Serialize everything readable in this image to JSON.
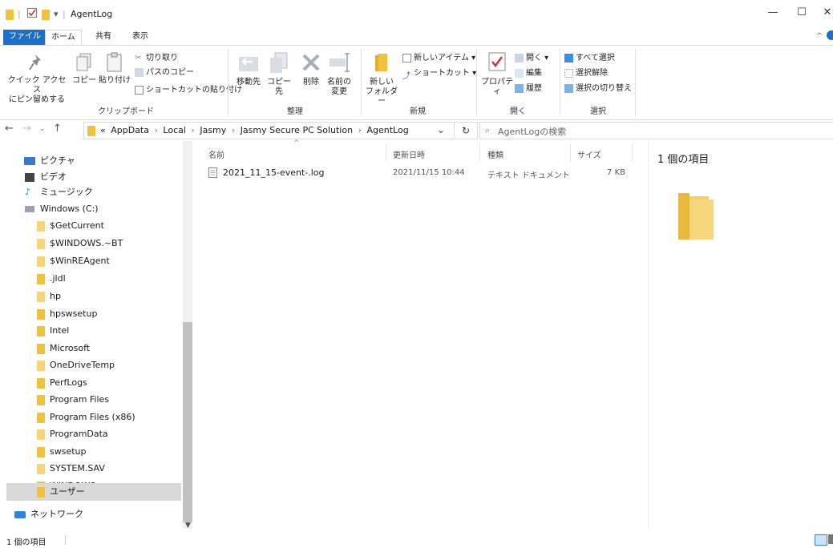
{
  "window": {
    "title": "AgentLog",
    "quick_access_sep": "|",
    "dropdown_glyph": "▾"
  },
  "ribbon_tabs": [
    "ファイル",
    "ホーム",
    "共有",
    "表示"
  ],
  "ribbon": {
    "clipboard": {
      "pin_label_1": "クイック アクセス",
      "pin_label_2": "にピン留めする",
      "copy": "コピー",
      "paste": "貼り付け",
      "cut": "切り取り",
      "copy_path": "パスのコピー",
      "paste_shortcut": "ショートカットの貼り付け",
      "group": "クリップボード"
    },
    "organize": {
      "move_to": "移動先",
      "copy_to": "コピー先",
      "delete": "削除",
      "rename_1": "名前の",
      "rename_2": "変更",
      "group": "整理"
    },
    "new": {
      "new_folder_1": "新しい",
      "new_folder_2": "フォルダー",
      "new_item": "新しいアイテム ▾",
      "shortcut": "ショートカット ▾",
      "group": "新規"
    },
    "open": {
      "properties": "プロパティ",
      "open": "開く ▾",
      "edit": "編集",
      "history": "履歴",
      "group": "開く"
    },
    "select": {
      "select_all": "すべて選択",
      "select_none": "選択解除",
      "invert": "選択の切り替え",
      "group": "選択"
    }
  },
  "address": {
    "crumbs": [
      "«",
      "AppData",
      "Local",
      "Jasmy",
      "Jasmy Secure PC Solution",
      "AgentLog"
    ],
    "search_placeholder": "AgentLogの検索",
    "refresh": "↻",
    "dropdown": "⌄"
  },
  "nav_pane": {
    "items": [
      {
        "label": "ピクチャ",
        "icon": "pictures-icon"
      },
      {
        "label": "ビデオ",
        "icon": "videos-icon"
      },
      {
        "label": "ミュージック",
        "icon": "music-icon"
      },
      {
        "label": "Windows (C:)",
        "icon": "drive-icon"
      },
      {
        "label": "$GetCurrent",
        "icon": "folder-icon"
      },
      {
        "label": "$WINDOWS.~BT",
        "icon": "folder-icon"
      },
      {
        "label": "$WinREAgent",
        "icon": "folder-icon"
      },
      {
        "label": ".jldl",
        "icon": "folder-icon"
      },
      {
        "label": "hp",
        "icon": "folder-icon"
      },
      {
        "label": "hpswsetup",
        "icon": "folder-icon"
      },
      {
        "label": "Intel",
        "icon": "folder-icon"
      },
      {
        "label": "Microsoft",
        "icon": "folder-icon"
      },
      {
        "label": "OneDriveTemp",
        "icon": "folder-icon"
      },
      {
        "label": "PerfLogs",
        "icon": "folder-icon"
      },
      {
        "label": "Program Files",
        "icon": "folder-icon"
      },
      {
        "label": "Program Files (x86)",
        "icon": "folder-icon"
      },
      {
        "label": "ProgramData",
        "icon": "folder-icon"
      },
      {
        "label": "swsetup",
        "icon": "folder-icon"
      },
      {
        "label": "SYSTEM.SAV",
        "icon": "folder-icon"
      },
      {
        "label": "WINDOWS",
        "icon": "folder-icon"
      },
      {
        "label": "ユーザー",
        "icon": "folder-icon"
      },
      {
        "label": "ネットワーク",
        "icon": "network-icon"
      }
    ]
  },
  "file_list": {
    "columns": [
      "名前",
      "更新日時",
      "種類",
      "サイズ"
    ],
    "rows": [
      {
        "name": "2021_11_15-event-.log",
        "modified": "2021/11/15 10:44",
        "type": "テキスト ドキュメント",
        "size": "7 KB"
      }
    ]
  },
  "details_pane": {
    "summary": "1 個の項目"
  },
  "status_bar": {
    "text": "1 個の項目"
  },
  "colors": {
    "file_tab": "#1e6fc8",
    "folder": "#f0c040",
    "selected": "#d9d9d9"
  }
}
